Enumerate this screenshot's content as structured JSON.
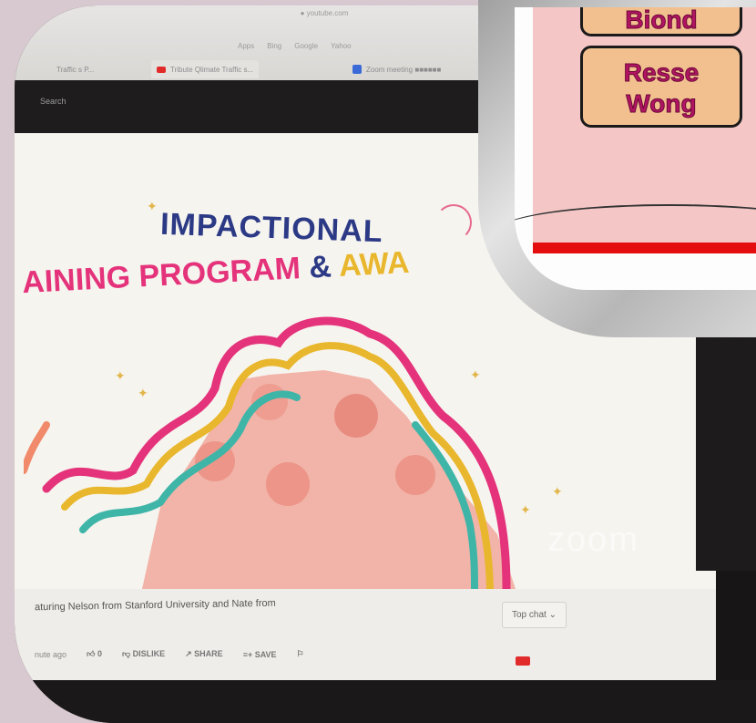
{
  "browser": {
    "url": "● youtube.com",
    "bookmarks": [
      "Apps",
      "Bing",
      "Google",
      "Yahoo"
    ],
    "tabs": [
      {
        "label": "Traffic s P...",
        "icon": "grey"
      },
      {
        "label": "Tribute Qlimate Traffic s..."
      },
      {
        "label": "Zoom meeting ■■■■■■"
      }
    ],
    "search_label": "Search"
  },
  "slide": {
    "title_line1": "IMPACTIONAL",
    "title_line2_pink": "AINING PROGRAM",
    "title_line2_amp": "&",
    "title_line2_gold": "AWA",
    "watermark": "zoom"
  },
  "video": {
    "caption": "aturing Nelson from Stanford University and Nate from",
    "top_chat": "Top chat",
    "time_ago": "nute ago",
    "like_count": "0",
    "dislike": "DISLIKE",
    "share": "SHARE",
    "save": "SAVE"
  },
  "overlay": {
    "name_top": "Biond",
    "name_line1": "Resse",
    "name_line2": "Wong"
  },
  "colors": {
    "navy": "#2c3a86",
    "pink": "#e4337b",
    "gold": "#e9b72d",
    "tag_bg": "#f2c08f",
    "tag_text": "#b21463",
    "red_bar": "#e50e0e"
  }
}
